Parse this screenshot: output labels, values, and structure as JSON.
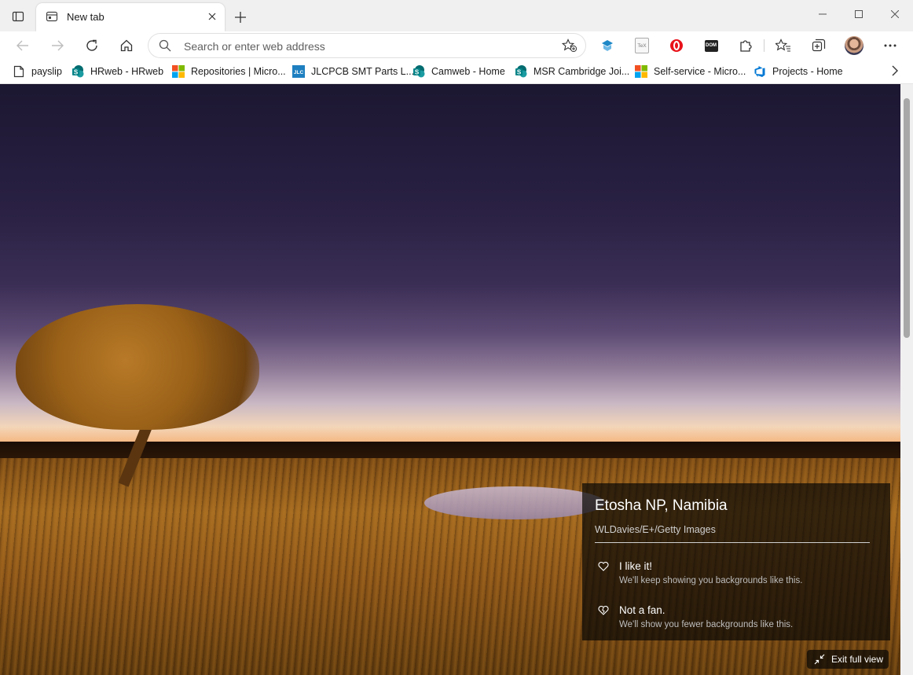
{
  "tab": {
    "title": "New tab"
  },
  "address_bar": {
    "placeholder": "Search or enter web address"
  },
  "bookmarks": [
    {
      "label": "payslip",
      "icon": "page-icon"
    },
    {
      "label": "HRweb - HRweb",
      "icon": "sharepoint-icon"
    },
    {
      "label": "Repositories | Micro...",
      "icon": "microsoft-logo-icon"
    },
    {
      "label": "JLCPCB SMT Parts L...",
      "icon": "jlc-icon"
    },
    {
      "label": "Camweb - Home",
      "icon": "sharepoint-icon"
    },
    {
      "label": "MSR Cambridge Joi...",
      "icon": "sharepoint-icon"
    },
    {
      "label": "Self-service - Micro...",
      "icon": "microsoft-logo-icon"
    },
    {
      "label": "Projects - Home",
      "icon": "azure-devops-icon"
    }
  ],
  "extension_labels": {
    "tex": "TeX",
    "dom": "DOM"
  },
  "background_info": {
    "location": "Etosha NP, Namibia",
    "credit": "WLDavies/E+/Getty Images",
    "like_title": "I like it!",
    "like_sub": "We'll keep showing you backgrounds like this.",
    "dislike_title": "Not a fan.",
    "dislike_sub": "We'll show you fewer backgrounds like this."
  },
  "exit_full_view": "Exit full view",
  "colors": {
    "tab_strip": "#f0f0f0",
    "overlay": "#0a0806",
    "brand_sharepoint": "#038387",
    "brand_ms_red": "#f25022"
  }
}
